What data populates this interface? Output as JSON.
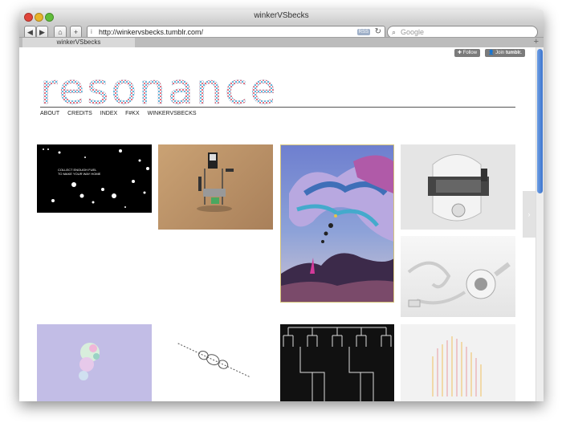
{
  "window": {
    "title": "winkerVSbecks"
  },
  "toolbar": {
    "back_icon": "◀",
    "forward_icon": "▶",
    "home_icon": "⌂",
    "add_icon": "+",
    "url": "http://winkervsbecks.tumblr.com/",
    "rss": "RSS",
    "reload_icon": "↻",
    "search_placeholder": "Google"
  },
  "tabs": [
    {
      "label": "winkerVSbecks"
    }
  ],
  "tumblr": {
    "follow": "Follow",
    "join_prefix": "Join",
    "join_brand": "tumblr."
  },
  "site": {
    "logo": "resonance",
    "nav": [
      "ABOUT",
      "CREDITS",
      "INDEX",
      "F#KX",
      "WINKERVSBECKS"
    ]
  },
  "tiles": {
    "game_caption_line1": "COLLECT ENOUGH FUEL",
    "game_caption_line2": "TO MAKE YOUR WAY HOME"
  }
}
